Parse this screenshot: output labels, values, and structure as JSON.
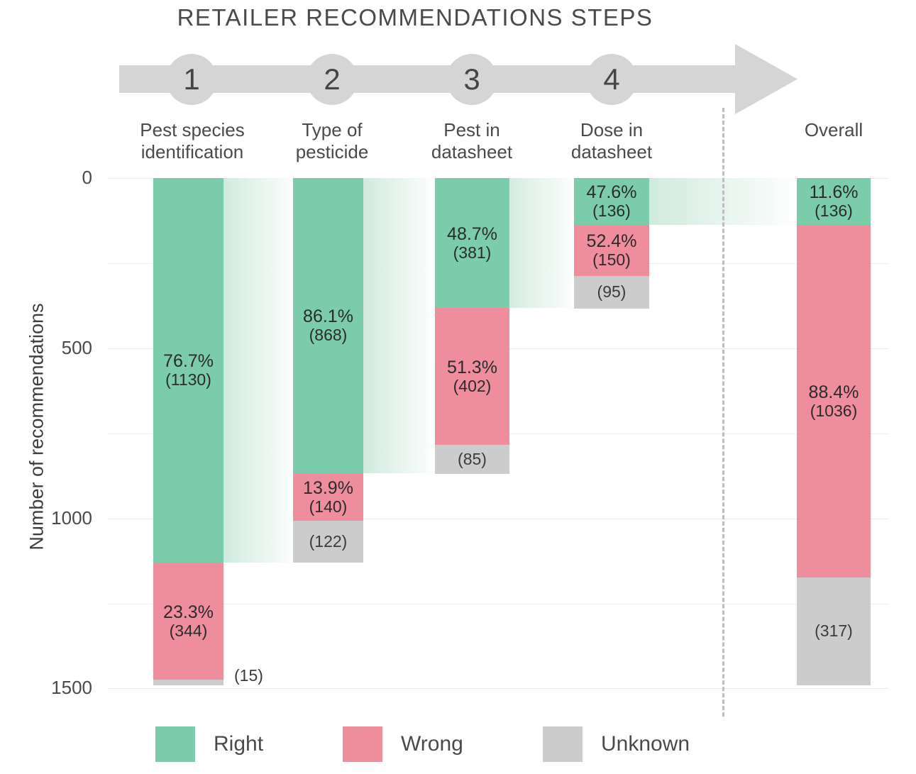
{
  "title": "RETAILER RECOMMENDATIONS STEPS",
  "process": {
    "steps": [
      {
        "number": "1"
      },
      {
        "number": "2"
      },
      {
        "number": "3"
      },
      {
        "number": "4"
      }
    ],
    "arrow_color": "#d5d5d5"
  },
  "axis": {
    "ylabel": "Number of recommendations",
    "yticks": [
      "0",
      "500",
      "1000",
      "1500"
    ],
    "ytick_values": [
      0,
      500,
      1000,
      1500
    ],
    "ylim": [
      0,
      1500
    ],
    "grid": "horizontal"
  },
  "legend": {
    "position": "bottom",
    "items": [
      {
        "label": "Right",
        "color": "#7ACCAB"
      },
      {
        "label": "Wrong",
        "color": "#EE8E9C"
      },
      {
        "label": "Unknown",
        "color": "#CCCCCC"
      }
    ]
  },
  "colors": {
    "right": "#7ACCAB",
    "wrong": "#EE8E9C",
    "unknown": "#CCCCCC",
    "ribbon": "#C9E8DC",
    "grid": "#efefef",
    "divider": "#bdbdbd",
    "text": "#3d3d3d"
  },
  "chart_data": {
    "type": "bar",
    "subtype": "stacked-funnel-waterfall",
    "title": "RETAILER RECOMMENDATIONS STEPS",
    "xlabel": "",
    "ylabel": "Number of recommendations",
    "ylim": [
      0,
      1500
    ],
    "yticks": [
      0,
      500,
      1000,
      1500
    ],
    "grid": true,
    "legend_position": "bottom",
    "categories": [
      "Pest species identification",
      "Type of pesticide",
      "Pest in datasheet",
      "Dose in datasheet",
      "Overall"
    ],
    "series": [
      {
        "name": "Right",
        "color": "#7ACCAB",
        "values": [
          1130,
          868,
          381,
          136,
          136
        ]
      },
      {
        "name": "Wrong",
        "color": "#EE8E9C",
        "values": [
          344,
          140,
          402,
          150,
          1036
        ]
      },
      {
        "name": "Unknown",
        "color": "#CCCCCC",
        "values": [
          15,
          122,
          85,
          95,
          317
        ]
      }
    ],
    "column_totals": [
      1489,
      1130,
      868,
      381,
      1489
    ],
    "columns": [
      {
        "header_line1": "Pest species",
        "header_line2": "identification",
        "step": "1",
        "total": 1489,
        "segments": [
          {
            "key": "right",
            "pct": "76.7%",
            "count": "(1130)",
            "value": 1130,
            "pct_value": 76.7,
            "label_inside": true
          },
          {
            "key": "wrong",
            "pct": "23.3%",
            "count": "(344)",
            "value": 344,
            "pct_value": 23.3,
            "label_inside": true
          },
          {
            "key": "unknown",
            "pct": "",
            "count": "(15)",
            "value": 15,
            "pct_value": null,
            "label_inside": false
          }
        ]
      },
      {
        "header_line1": "Type of",
        "header_line2": "pesticide",
        "step": "2",
        "total": 1130,
        "segments": [
          {
            "key": "right",
            "pct": "86.1%",
            "count": "(868)",
            "value": 868,
            "pct_value": 86.1,
            "label_inside": true
          },
          {
            "key": "wrong",
            "pct": "13.9%",
            "count": "(140)",
            "value": 140,
            "pct_value": 13.9,
            "label_inside": true
          },
          {
            "key": "unknown",
            "pct": "",
            "count": "(122)",
            "value": 122,
            "pct_value": null,
            "label_inside": true
          }
        ]
      },
      {
        "header_line1": "Pest in",
        "header_line2": "datasheet",
        "step": "3",
        "total": 868,
        "segments": [
          {
            "key": "right",
            "pct": "48.7%",
            "count": "(381)",
            "value": 381,
            "pct_value": 48.7,
            "label_inside": true
          },
          {
            "key": "wrong",
            "pct": "51.3%",
            "count": "(402)",
            "value": 402,
            "pct_value": 51.3,
            "label_inside": true
          },
          {
            "key": "unknown",
            "pct": "",
            "count": "(85)",
            "value": 85,
            "pct_value": null,
            "label_inside": true
          }
        ]
      },
      {
        "header_line1": "Dose in",
        "header_line2": "datasheet",
        "step": "4",
        "total": 381,
        "segments": [
          {
            "key": "right",
            "pct": "47.6%",
            "count": "(136)",
            "value": 136,
            "pct_value": 47.6,
            "label_inside": true
          },
          {
            "key": "wrong",
            "pct": "52.4%",
            "count": "(150)",
            "value": 150,
            "pct_value": 52.4,
            "label_inside": true
          },
          {
            "key": "unknown",
            "pct": "",
            "count": "(95)",
            "value": 95,
            "pct_value": null,
            "label_inside": true
          }
        ]
      },
      {
        "header_line1": "Overall",
        "header_line2": "",
        "step": "",
        "total": 1489,
        "segments": [
          {
            "key": "right",
            "pct": "11.6%",
            "count": "(136)",
            "value": 136,
            "pct_value": 11.6,
            "label_inside": true
          },
          {
            "key": "wrong",
            "pct": "88.4%",
            "count": "(1036)",
            "value": 1036,
            "pct_value": 88.4,
            "label_inside": true
          },
          {
            "key": "unknown",
            "pct": "",
            "count": "(317)",
            "value": 317,
            "pct_value": null,
            "label_inside": true
          }
        ]
      }
    ]
  }
}
